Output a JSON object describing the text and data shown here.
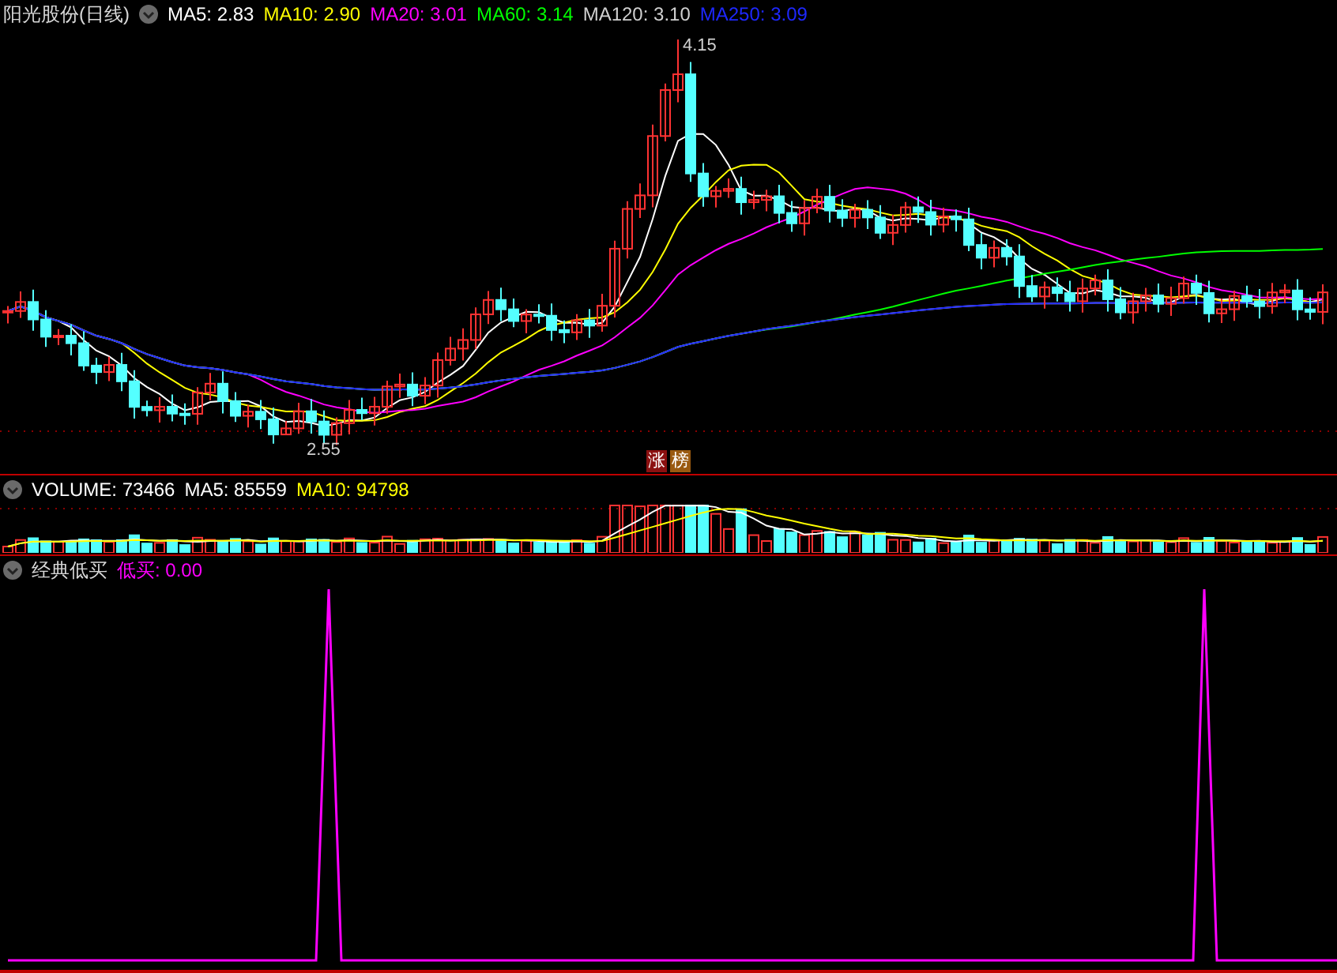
{
  "chart_title": "阳光股份(日线)",
  "ma_legend": [
    {
      "label": "MA5: 2.83",
      "color": "#ffffff"
    },
    {
      "label": "MA10: 2.90",
      "color": "#ffff00"
    },
    {
      "label": "MA20: 3.01",
      "color": "#ff00ff"
    },
    {
      "label": "MA60: 3.14",
      "color": "#00ff00"
    },
    {
      "label": "MA120: 3.10",
      "color": "#d0d0d0"
    },
    {
      "label": "MA250: 3.09",
      "color": "#1e28ff"
    }
  ],
  "price_markers": [
    {
      "label": "4.15",
      "kind": "high"
    },
    {
      "label": "2.55",
      "kind": "low"
    }
  ],
  "badges": [
    {
      "label": "涨",
      "color": "#8b1010"
    },
    {
      "label": "榜",
      "color": "#9a5a10"
    }
  ],
  "volume_legend": [
    {
      "label": "VOLUME: 73466",
      "color": "#ffffff"
    },
    {
      "label": "MA5: 85559",
      "color": "#ffffff"
    },
    {
      "label": "MA10: 94798",
      "color": "#ffff00"
    }
  ],
  "indicator": {
    "title": "经典低买",
    "legend": [
      {
        "label": "低买: 0.00",
        "color": "#ff00ff"
      }
    ]
  }
}
